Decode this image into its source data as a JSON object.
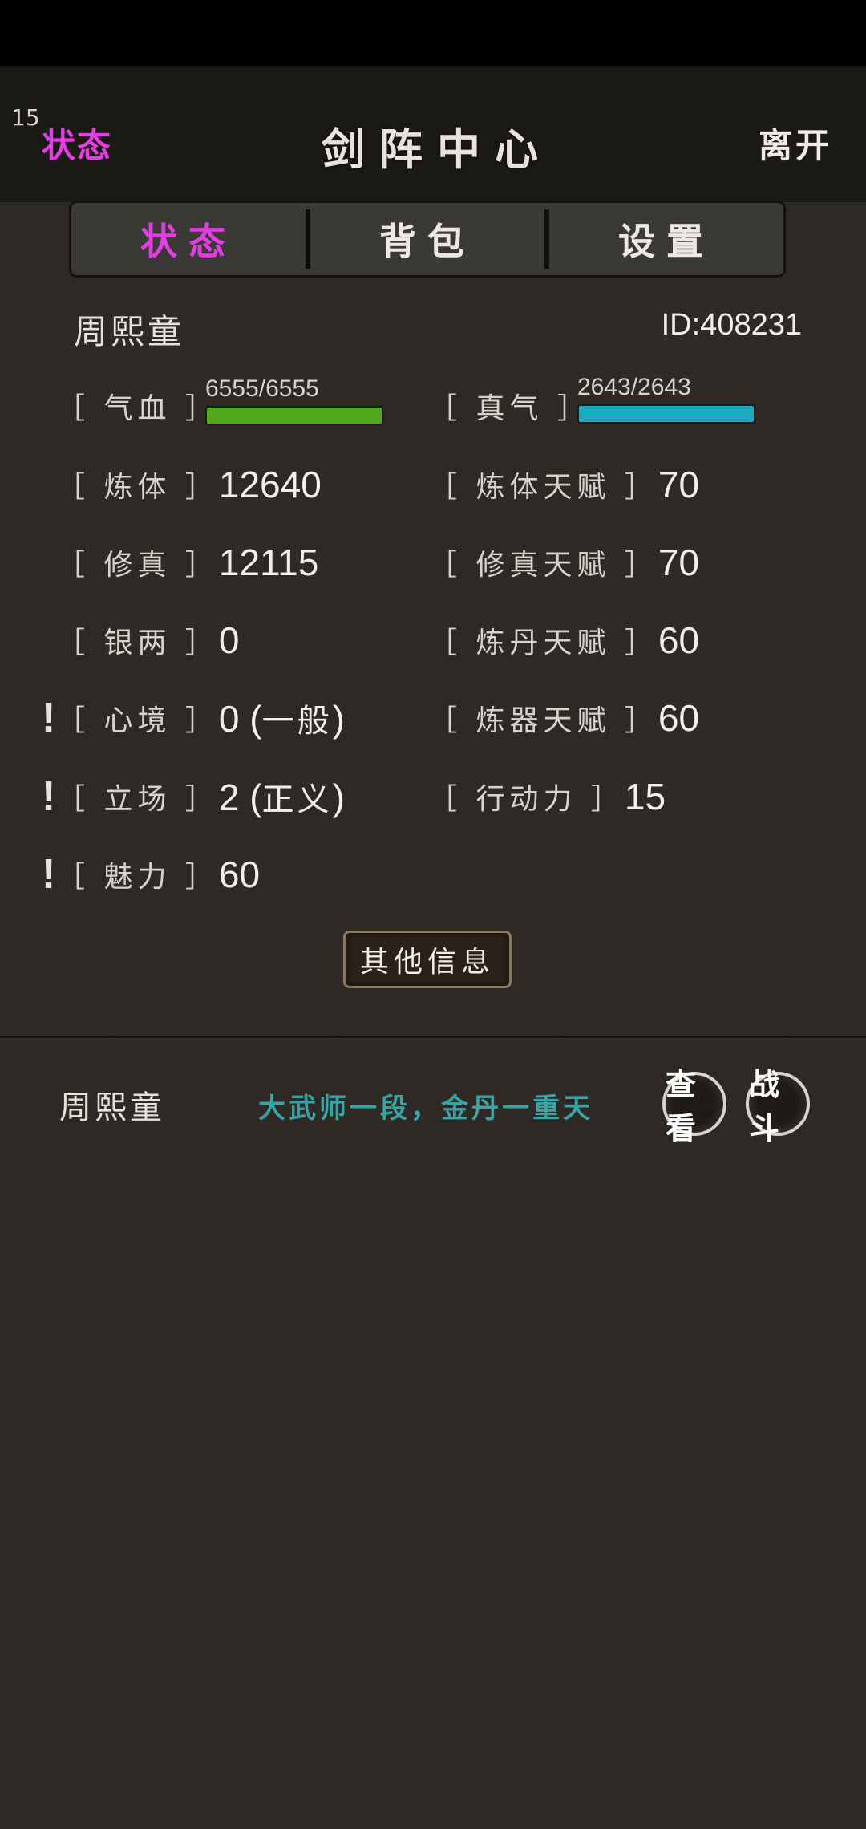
{
  "header": {
    "level": "15",
    "left_label": "状态",
    "title": "剑阵中心",
    "right_label": "离开"
  },
  "tabs": [
    {
      "label": "状态",
      "active": true
    },
    {
      "label": "背包",
      "active": false
    },
    {
      "label": "设置",
      "active": false
    }
  ],
  "player": {
    "name": "周熙童",
    "id": "ID:408231"
  },
  "bars": {
    "hp": {
      "label": "［ 气血 ］",
      "text": "6555/6555",
      "fill": 1.0,
      "color": "#4fa81d"
    },
    "mp": {
      "label": "［ 真气 ］",
      "text": "2643/2643",
      "fill": 1.0,
      "color": "#1fa8c2"
    }
  },
  "stats_left": [
    {
      "label": "［ 炼体 ］",
      "value": "12640",
      "note": ""
    },
    {
      "label": "［ 修真 ］",
      "value": "12115",
      "note": ""
    },
    {
      "label": "［ 银两 ］",
      "value": "0",
      "note": ""
    },
    {
      "label": "［ 心境 ］",
      "value": "0 (",
      "note": "一般",
      "suffix": ")",
      "alert": "!"
    },
    {
      "label": "［ 立场 ］",
      "value": "2 (",
      "note": "正义",
      "suffix": ")",
      "alert": "!"
    },
    {
      "label": "［ 魅力 ］",
      "value": "60",
      "note": "",
      "alert": "!"
    }
  ],
  "stats_right": [
    {
      "label": "［ 炼体天赋 ］",
      "value": "70"
    },
    {
      "label": "［ 修真天赋 ］",
      "value": "70"
    },
    {
      "label": "［ 炼丹天赋 ］",
      "value": "60"
    },
    {
      "label": "［ 炼器天赋 ］",
      "value": "60"
    },
    {
      "label": "［ 行动力 ］",
      "value": "15"
    }
  ],
  "other_info_label": "其他信息",
  "list": {
    "name": "周熙童",
    "rank": "大武师一段，金丹一重天",
    "view_label": "查看",
    "fight_label": "战斗"
  }
}
